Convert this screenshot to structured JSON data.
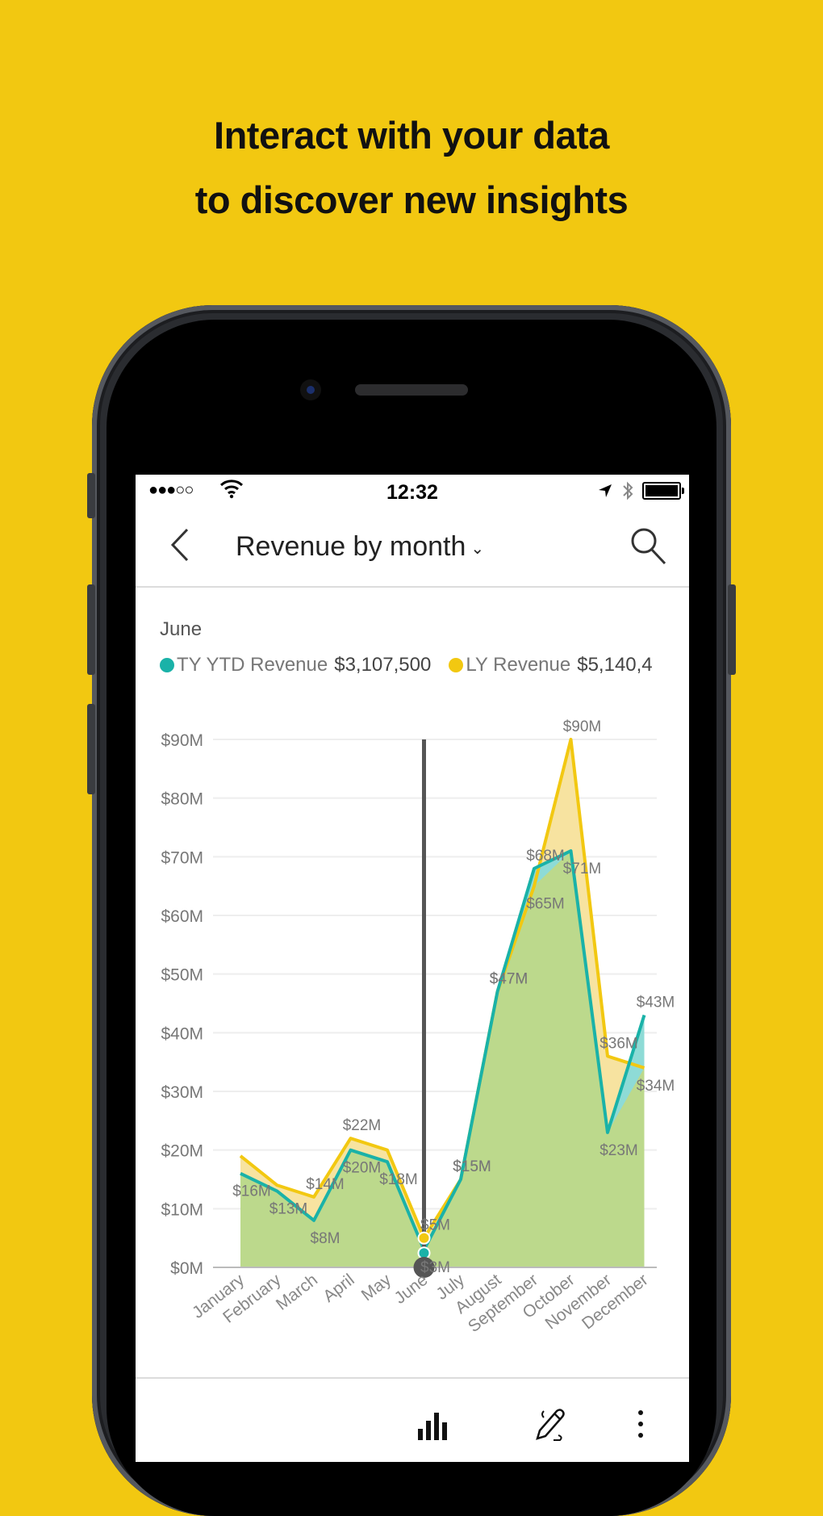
{
  "headline": {
    "line1": "Interact with your data",
    "line2": "to discover new insights"
  },
  "status_bar": {
    "signal": "●●●○○",
    "time": "12:32",
    "icons": [
      "wifi-icon",
      "location-arrow-icon",
      "bluetooth-icon",
      "battery-icon"
    ]
  },
  "nav": {
    "back_icon": "chevron-left-icon",
    "title": "Revenue by month",
    "title_dropdown_icon": "chevron-down-icon",
    "search_icon": "search-icon"
  },
  "tooltip": {
    "month": "June",
    "series": [
      {
        "label": "TY YTD Revenue",
        "value": "$3,107,500",
        "color": "#1AB2A8"
      },
      {
        "label": "LY Revenue",
        "value": "$5,140,4",
        "color": "#F2C811"
      }
    ]
  },
  "bottom_bar": {
    "icons": [
      "bar-chart-icon",
      "pen-annotate-icon",
      "more-vertical-icon"
    ]
  },
  "colors": {
    "background": "#F2C811",
    "ty_line": "#1AB2A8",
    "ly_line": "#F2C811",
    "ty_fill": "#BCD98C",
    "ly_fill": "#F7E3A0",
    "ty_over_fill": "#8EDBD6",
    "gridline": "#EEEEEE",
    "cursor": "#555555"
  },
  "chart_data": {
    "type": "area",
    "title": "Revenue by month",
    "xlabel": "",
    "ylabel": "",
    "categories": [
      "January",
      "February",
      "March",
      "April",
      "May",
      "June",
      "July",
      "August",
      "September",
      "October",
      "November",
      "December"
    ],
    "y_ticks": [
      "$0M",
      "$10M",
      "$20M",
      "$30M",
      "$40M",
      "$50M",
      "$60M",
      "$70M",
      "$80M",
      "$90M"
    ],
    "ylim": [
      0,
      90
    ],
    "grid": true,
    "legend": "top-left",
    "selected_category": "June",
    "series": [
      {
        "name": "TY YTD Revenue",
        "values": [
          16,
          13,
          8,
          20,
          18,
          3,
          15,
          47,
          68,
          71,
          23,
          43
        ],
        "labels": [
          "$16M",
          "$13M",
          "$8M",
          "$20M",
          "$18M",
          "$3M",
          "$15M",
          "$47M",
          "$68M",
          "$71M",
          "$23M",
          "$43M"
        ]
      },
      {
        "name": "LY Revenue",
        "values": [
          19,
          14,
          12,
          22,
          20,
          5,
          15,
          47,
          65,
          90,
          36,
          34
        ],
        "labels": [
          "",
          "",
          "$14M",
          "$22M",
          "",
          "$5M",
          "$15M",
          "$47M",
          "$65M",
          "$90M",
          "$36M",
          "$34M"
        ]
      }
    ]
  }
}
